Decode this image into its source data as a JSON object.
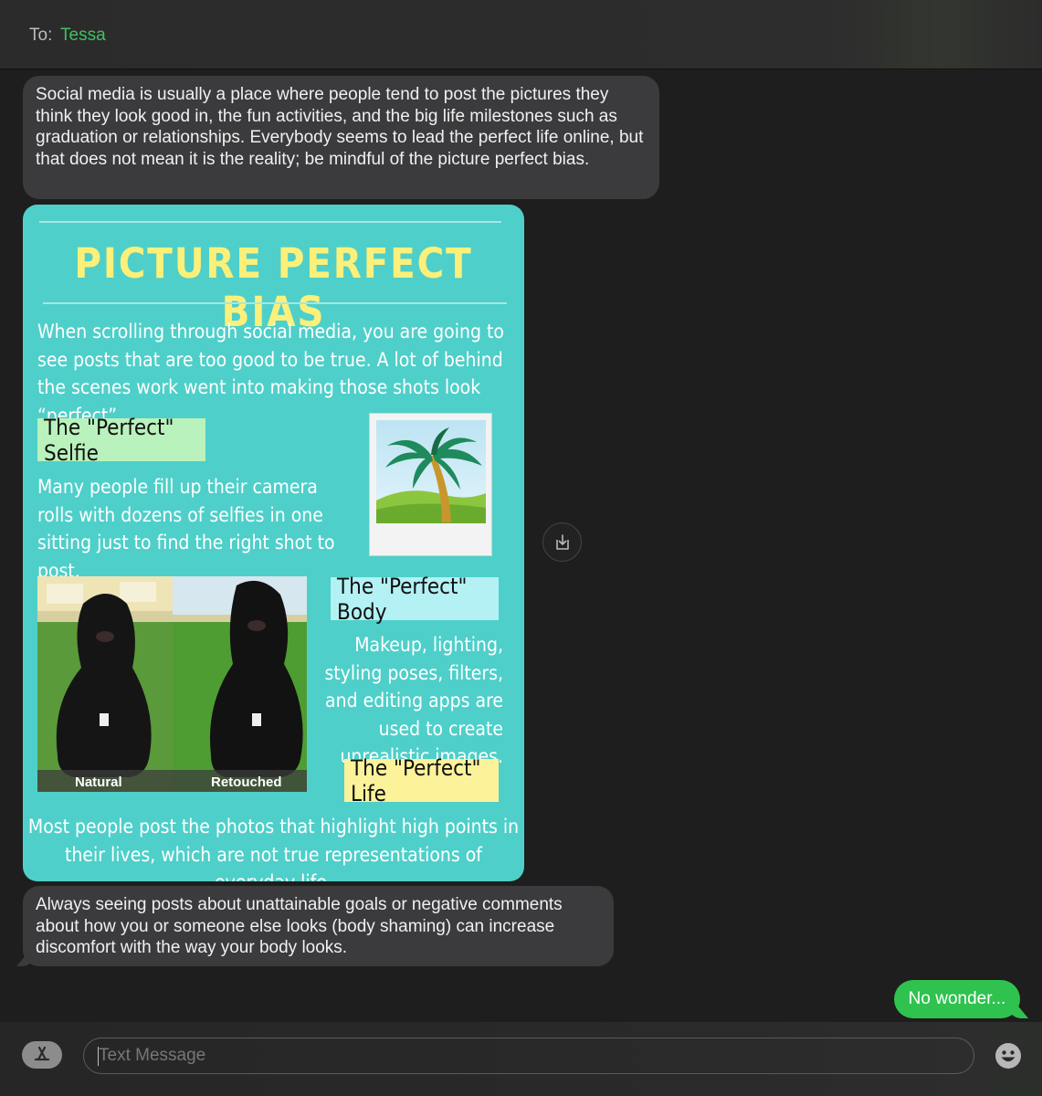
{
  "header": {
    "to_label": "To:",
    "recipient": "Tessa"
  },
  "messages": {
    "first": "Social media is usually a place where people tend to post the pictures they think they look good in, the fun activities, and the big life milestones such as graduation or relationships. Everybody seems to lead the perfect life online, but that does not mean it is the reality; be mindful of the picture perfect bias.",
    "third": "Always seeing posts about unattainable goals or negative comments about how you or someone else looks (body shaming) can increase discomfort with the way your body looks.",
    "reply": "No wonder..."
  },
  "infographic": {
    "title": "PICTURE PERFECT BIAS",
    "intro": "When scrolling through social media, you are going to see posts that are too good to be true. A lot of behind the scenes work went into making those shots look “perfect”.",
    "selfie_heading": "The \"Perfect\" Selfie",
    "selfie_text": "Many people fill up their camera rolls with dozens of selfies in one sitting just to find the right shot to post.",
    "body_heading": "The \"Perfect\" Body",
    "body_text": "Makeup, lighting, styling poses, filters, and editing apps are used to create unrealistic images.",
    "life_heading": "The \"Perfect\" Life",
    "life_text": "Most people post the photos that highlight high points in their lives, which are not true representations of everyday life.",
    "caption_left": "Natural",
    "caption_right": "Retouched"
  },
  "composer": {
    "placeholder": "Text Message"
  },
  "icons": {
    "save": "save-attachment-icon",
    "apps": "app-store-icon",
    "emoji": "emoji-icon"
  },
  "colors": {
    "incoming_bubble": "#3b3b3d",
    "outgoing_bubble": "#30c24e",
    "infographic_bg": "#4fcfc9",
    "title": "#fbf07a",
    "recipient": "#3fc060"
  }
}
